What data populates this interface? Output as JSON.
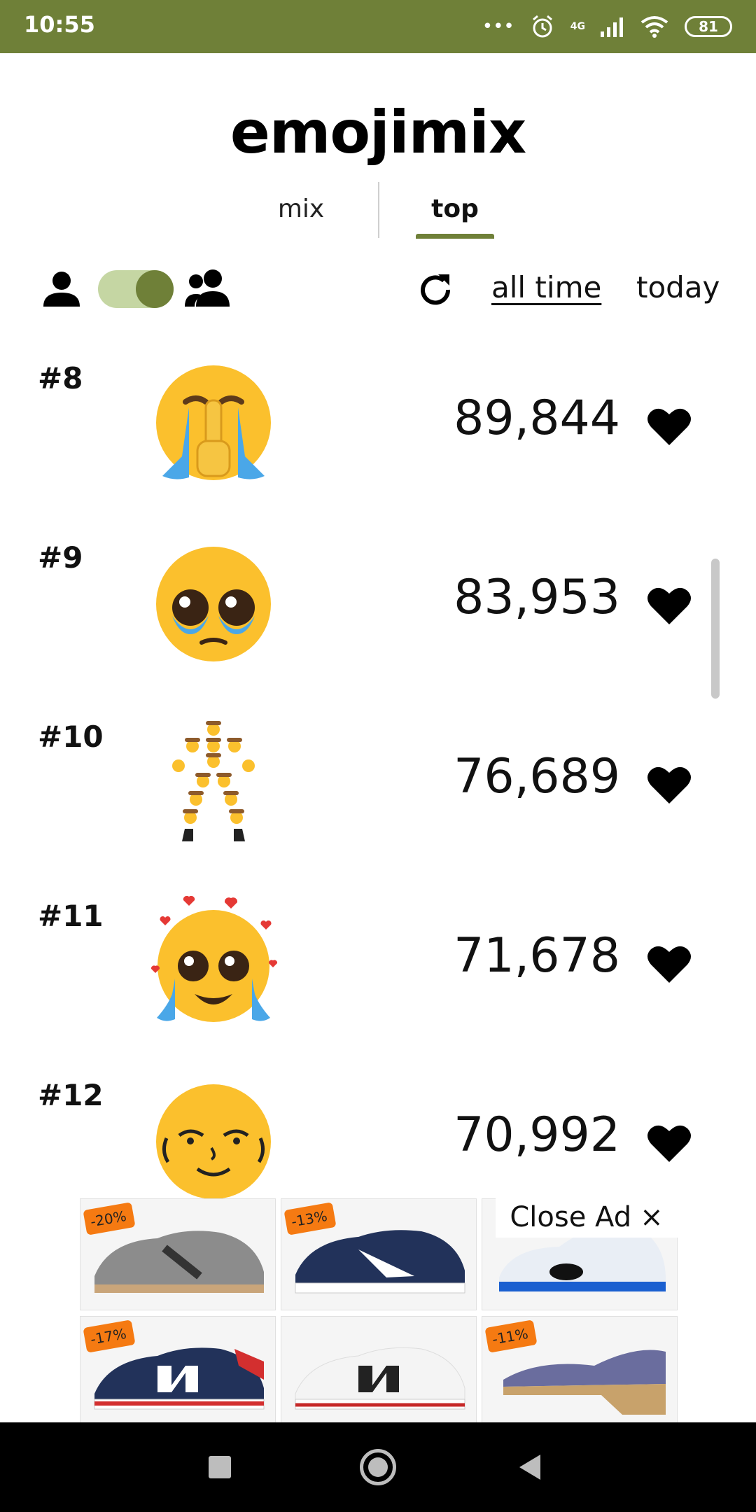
{
  "status_bar": {
    "time": "10:55",
    "dots": "•••",
    "network": "4G",
    "battery": "81"
  },
  "app": {
    "title": "emojimix"
  },
  "tabs": [
    {
      "label": "mix",
      "selected": false
    },
    {
      "label": "top",
      "selected": true
    }
  ],
  "toolbar": {
    "toggle_on": true,
    "filters": [
      {
        "label": "all time",
        "selected": true
      },
      {
        "label": "today",
        "selected": false
      }
    ]
  },
  "list": {
    "items": [
      {
        "rank": "#8",
        "count": "89,844",
        "emoji": "crying-shushing-face"
      },
      {
        "rank": "#9",
        "count": "83,953",
        "emoji": "pleading-crying-face"
      },
      {
        "rank": "#10",
        "count": "76,689",
        "emoji": "cowboy-figure"
      },
      {
        "rank": "#11",
        "count": "71,678",
        "emoji": "loving-crying-face"
      },
      {
        "rank": "#12",
        "count": "70,992",
        "emoji": "lenny-face"
      }
    ]
  },
  "ad": {
    "close_label": "Close Ad",
    "close_glyph": "×",
    "tiles": [
      {
        "discount": "-20%",
        "product": "grey-sneaker"
      },
      {
        "discount": "-13%",
        "product": "navy-sneaker"
      },
      {
        "discount": "",
        "product": "white-blue-basketball-shoe"
      },
      {
        "discount": "-17%",
        "product": "navy-red-sneaker"
      },
      {
        "discount": "",
        "product": "white-black-sneaker"
      },
      {
        "discount": "-11%",
        "product": "purple-sandal"
      }
    ]
  },
  "colors": {
    "brand": "#6f8038",
    "toggle_track": "#c5d6a3",
    "emoji_yellow": "#fbc02d",
    "tear_blue": "#4aa7e8",
    "heart_red": "#e53935",
    "discount_orange": "#f57a12"
  }
}
